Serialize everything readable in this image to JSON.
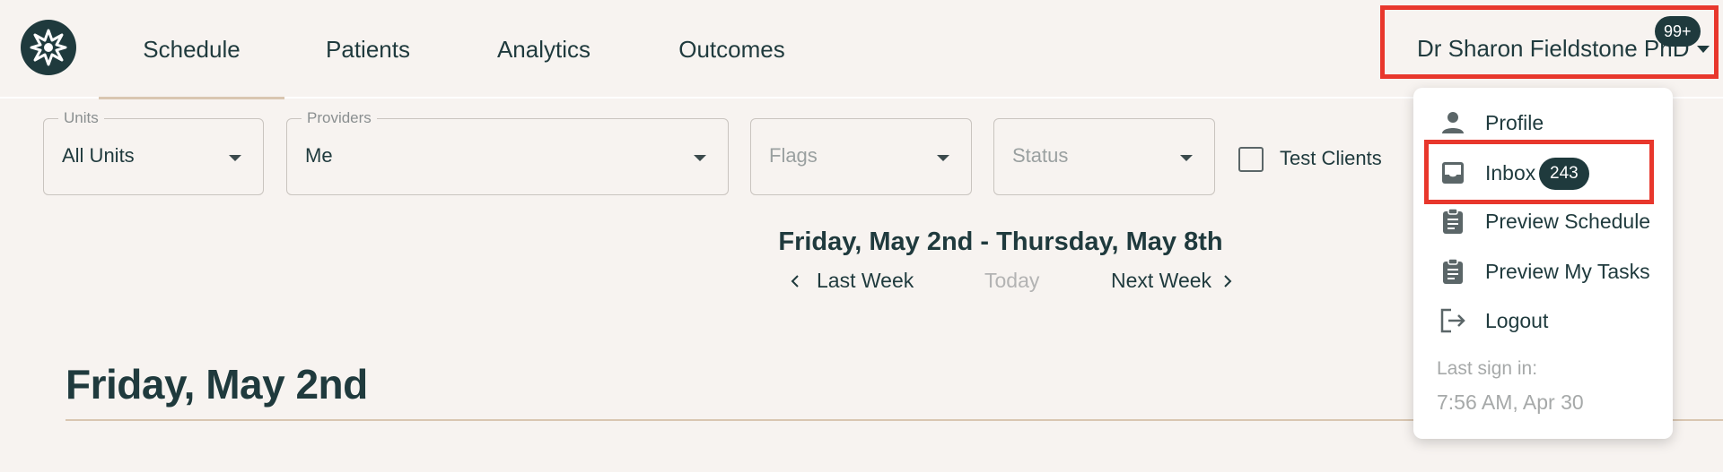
{
  "nav": {
    "tabs": [
      {
        "label": "Schedule",
        "active": true
      },
      {
        "label": "Patients",
        "active": false
      },
      {
        "label": "Analytics",
        "active": false
      },
      {
        "label": "Outcomes",
        "active": false
      }
    ],
    "user_name": "Dr Sharon Fieldstone PhD",
    "notification_count": "99+"
  },
  "filters": {
    "units": {
      "label": "Units",
      "value": "All Units"
    },
    "providers": {
      "label": "Providers",
      "value": "Me"
    },
    "flags": {
      "placeholder": "Flags"
    },
    "status": {
      "placeholder": "Status"
    },
    "test_clients": {
      "label": "Test Clients",
      "checked": false
    }
  },
  "date_range": {
    "title": "Friday, May 2nd - Thursday, May 8th",
    "last_week": "Last Week",
    "today": "Today",
    "next_week": "Next Week"
  },
  "day": {
    "heading": "Friday, May 2nd"
  },
  "user_dropdown": {
    "items": [
      {
        "label": "Profile",
        "icon": "person-icon"
      },
      {
        "label": "Inbox",
        "icon": "inbox-icon",
        "badge": "243"
      },
      {
        "label": "Preview Schedule",
        "icon": "clipboard-icon"
      },
      {
        "label": "Preview My Tasks",
        "icon": "clipboard-icon"
      },
      {
        "label": "Logout",
        "icon": "logout-icon"
      }
    ],
    "last_sign_in_label": "Last sign in:",
    "last_sign_in_value": "7:56 AM, Apr 30"
  },
  "colors": {
    "background": "#f7f3f0",
    "primary": "#1f3a3d",
    "accent_underline": "#d9c6b1",
    "highlight_box": "#e8372c"
  }
}
